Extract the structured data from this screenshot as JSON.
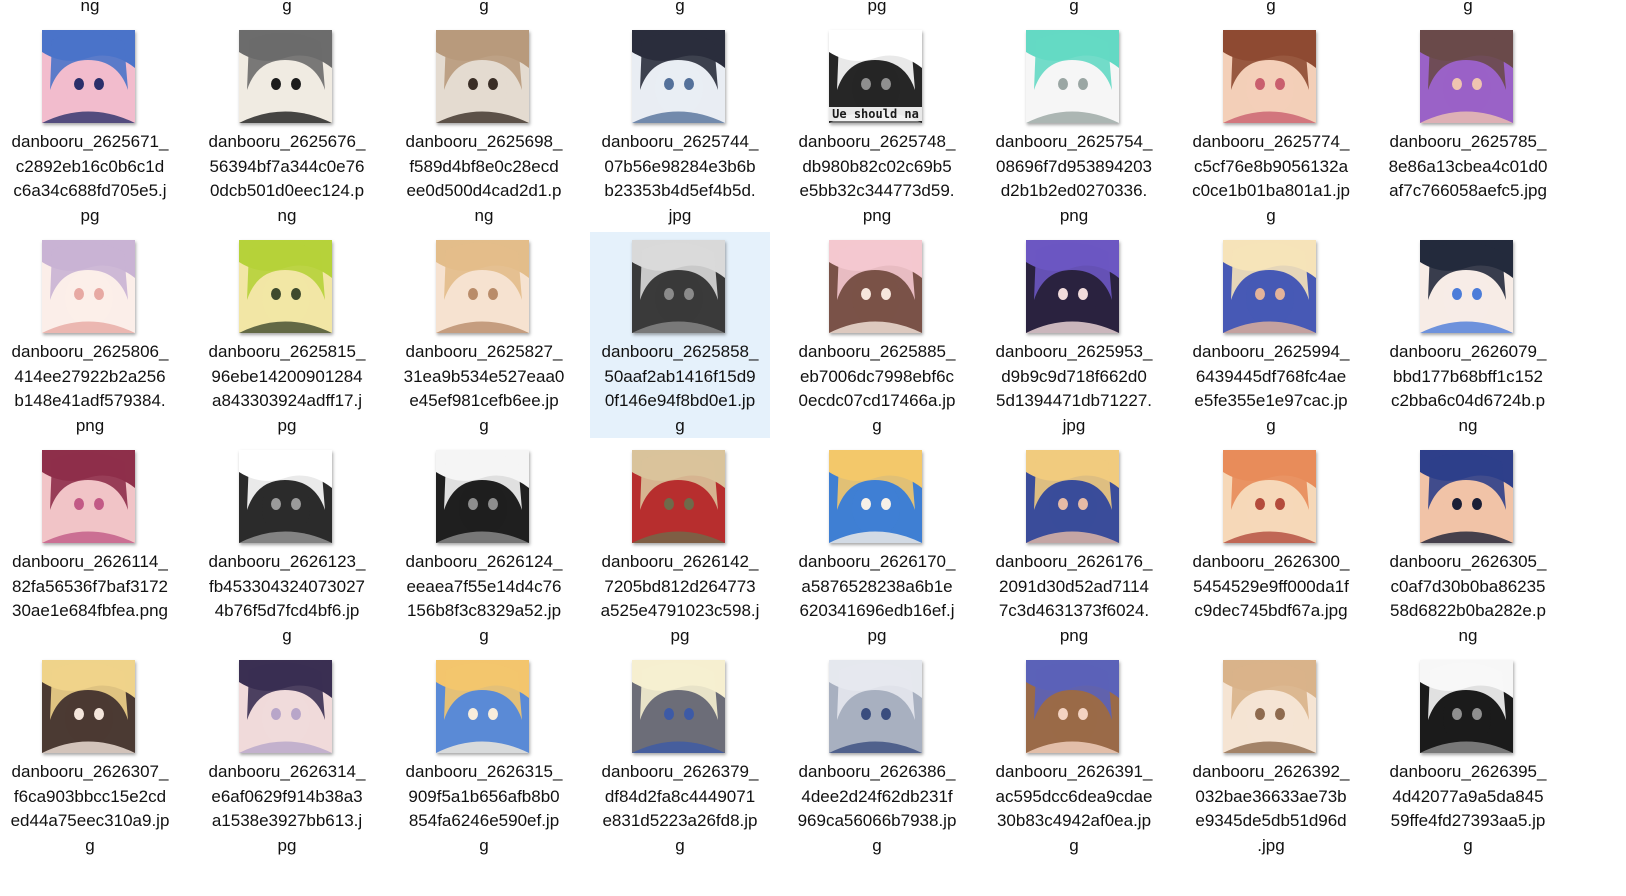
{
  "top_row_tails": [
    "ng",
    "g",
    "g",
    "g",
    "pg",
    "g",
    "g",
    "g"
  ],
  "files": [
    {
      "name_lines": [
        "danbooru_2625671_",
        "c2892eb16c0b6c1d",
        "c6a34c688fd705e5.j",
        "pg"
      ],
      "colors": [
        "#4a73c9",
        "#f2bccd",
        "#2b2f6a"
      ],
      "thumb_caption": ""
    },
    {
      "name_lines": [
        "danbooru_2625676_",
        "56394bf7a344c0e76",
        "0dcb501d0eec124.p",
        "ng"
      ],
      "colors": [
        "#6c6c6c",
        "#f0ebe2",
        "#1c1c1c"
      ],
      "thumb_caption": ""
    },
    {
      "name_lines": [
        "danbooru_2625698_",
        "f589d4bf8e0c28ecd",
        "ee0d500d4cad2d1.p",
        "ng"
      ],
      "colors": [
        "#b89a7c",
        "#e4dbd0",
        "#3a2e26"
      ],
      "thumb_caption": ""
    },
    {
      "name_lines": [
        "danbooru_2625744_",
        "07b56e98284e3b6b",
        "b23353b4d5ef4b5d.",
        "jpg"
      ],
      "colors": [
        "#2a2d3c",
        "#e9edf3",
        "#54719a"
      ],
      "thumb_caption": ""
    },
    {
      "name_lines": [
        "danbooru_2625748_",
        "db980b82c02c69b5",
        "e5bb32c344773d59.",
        "png"
      ],
      "colors": [
        "#ffffff",
        "#262626",
        "#8f8f8f"
      ],
      "thumb_caption": "Ue should na"
    },
    {
      "name_lines": [
        "danbooru_2625754_",
        "08696f7d953894203",
        "d2b1b2ed0270336.",
        "png"
      ],
      "colors": [
        "#64d9c4",
        "#f6f6f6",
        "#9aa6a3"
      ],
      "thumb_caption": ""
    },
    {
      "name_lines": [
        "danbooru_2625774_",
        "c5cf76e8b9056132a",
        "c0ce1b01ba801a1.jp",
        "g"
      ],
      "colors": [
        "#8e4a32",
        "#f3cfb8",
        "#c95f6e"
      ],
      "thumb_caption": ""
    },
    {
      "name_lines": [
        "danbooru_2625785_",
        "8e86a13cbea4c01d0",
        "af7c766058aefc5.jpg"
      ],
      "colors": [
        "#6a4a4a",
        "#9a62c7",
        "#efc4b0"
      ],
      "thumb_caption": ""
    },
    {
      "name_lines": [
        "danbooru_2625806_",
        "414ee27922b2a256",
        "b148e41adf579384.",
        "png"
      ],
      "colors": [
        "#c9b3d4",
        "#fbeee9",
        "#e7a9a3"
      ],
      "thumb_caption": ""
    },
    {
      "name_lines": [
        "danbooru_2625815_",
        "96ebe14200901284",
        "a843303924adff17.j",
        "pg"
      ],
      "colors": [
        "#b6d23a",
        "#f2e6a5",
        "#3f4a2d"
      ],
      "thumb_caption": ""
    },
    {
      "name_lines": [
        "danbooru_2625827_",
        "31ea9b534e527eaa0",
        "e45ef981cefb6ee.jp",
        "g"
      ],
      "colors": [
        "#e3bd8a",
        "#f6e2d0",
        "#b98c6a"
      ],
      "thumb_caption": ""
    },
    {
      "name_lines": [
        "danbooru_2625858_",
        "50aaf2ab1416f15d9",
        "0f146e94f8bd0e1.jp",
        "g"
      ],
      "colors": [
        "#d9d9d9",
        "#3a3a3a",
        "#8a8a8a"
      ],
      "thumb_caption": "",
      "selected": true
    },
    {
      "name_lines": [
        "danbooru_2625885_",
        "eb7006dc7998ebf6c",
        "0ecdc07cd17466a.jp",
        "g"
      ],
      "colors": [
        "#f4c8cf",
        "#7a5248",
        "#f6e7dd"
      ],
      "thumb_caption": ""
    },
    {
      "name_lines": [
        "danbooru_2625953_",
        "d9b9c9d718f662d0",
        "5d1394471db71227.",
        "jpg"
      ],
      "colors": [
        "#6c57c2",
        "#2a223f",
        "#f2dcdc"
      ],
      "thumb_caption": ""
    },
    {
      "name_lines": [
        "danbooru_2625994_",
        "6439445df768fc4ae",
        "e5fe355e1e97cac.jp",
        "g"
      ],
      "colors": [
        "#f6e3b9",
        "#4759b5",
        "#e3b39a"
      ],
      "thumb_caption": ""
    },
    {
      "name_lines": [
        "danbooru_2626079_",
        "bbd177b68bff1c152",
        "c2bba6c04d6724b.p",
        "ng"
      ],
      "colors": [
        "#232a3c",
        "#f7ece6",
        "#4b7cd9"
      ],
      "thumb_caption": ""
    },
    {
      "name_lines": [
        "danbooru_2626114_",
        "82fa56536f7baf3172",
        "30ae1e684fbfea.png"
      ],
      "colors": [
        "#8e2f4a",
        "#f1c4c7",
        "#c25a86"
      ],
      "thumb_caption": ""
    },
    {
      "name_lines": [
        "danbooru_2626123_",
        "fb453304324073027",
        "4b76f5d7fcd4bf6.jp",
        "g"
      ],
      "colors": [
        "#ffffff",
        "#2b2b2b",
        "#9a9a9a"
      ],
      "thumb_caption": ""
    },
    {
      "name_lines": [
        "danbooru_2626124_",
        "eeaea7f55e14d4c76",
        "156b8f3c8329a52.jp",
        "g"
      ],
      "colors": [
        "#f5f5f5",
        "#1f1f1f",
        "#8d8d8d"
      ],
      "thumb_caption": ""
    },
    {
      "name_lines": [
        "danbooru_2626142_",
        "7205bd812d264773",
        "a525e4791023c598.j",
        "pg"
      ],
      "colors": [
        "#d9c39b",
        "#b72e2e",
        "#6f6a4a"
      ],
      "thumb_caption": ""
    },
    {
      "name_lines": [
        "danbooru_2626170_",
        "a5876528238a6b1e",
        "620341696edb16ef.j",
        "pg"
      ],
      "colors": [
        "#f3c86a",
        "#3f7fd3",
        "#f7f1e8"
      ],
      "thumb_caption": ""
    },
    {
      "name_lines": [
        "danbooru_2626176_",
        "2091d30d52ad7114",
        "7c3d4631373f6024.",
        "png"
      ],
      "colors": [
        "#f1cb7e",
        "#3a4c9a",
        "#e7bba6"
      ],
      "thumb_caption": ""
    },
    {
      "name_lines": [
        "danbooru_2626300_",
        "5454529e9ff000da1f",
        "c9dec745bdf67a.jpg"
      ],
      "colors": [
        "#e88c5a",
        "#f6d8b8",
        "#b34b3c"
      ],
      "thumb_caption": ""
    },
    {
      "name_lines": [
        "danbooru_2626305_",
        "c0af7d30b0ba86235",
        "58d6822b0ba282e.p",
        "ng"
      ],
      "colors": [
        "#2e3f8a",
        "#f1c3a7",
        "#1b1f36"
      ],
      "thumb_caption": ""
    },
    {
      "name_lines": [
        "danbooru_2626307_",
        "f6ca903bbcc15e2cd",
        "ed44a75eec310a9.jp",
        "g"
      ],
      "colors": [
        "#efd38a",
        "#4b3a33",
        "#f4e6dc"
      ],
      "thumb_caption": ""
    },
    {
      "name_lines": [
        "danbooru_2626314_",
        "e6af0629f914b38a3",
        "a1538e3927bb613.j",
        "pg"
      ],
      "colors": [
        "#3a2f52",
        "#f0dada",
        "#b8a6c9"
      ],
      "thumb_caption": ""
    },
    {
      "name_lines": [
        "danbooru_2626315_",
        "909f5a1b656afb8b0",
        "854fa6246e590ef.jp",
        "g"
      ],
      "colors": [
        "#f3c56d",
        "#5a8ad6",
        "#f8eddc"
      ],
      "thumb_caption": ""
    },
    {
      "name_lines": [
        "danbooru_2626379_",
        "df84d2fa8c4449071",
        "e831d5223a26fd8.jp",
        "g"
      ],
      "colors": [
        "#f6efd0",
        "#6c6d78",
        "#3d5aa6"
      ],
      "thumb_caption": ""
    },
    {
      "name_lines": [
        "danbooru_2626386_",
        "4dee2d24f62db231f",
        "969ca56066b7938.jp",
        "g"
      ],
      "colors": [
        "#e5e8ee",
        "#a8b0c0",
        "#3a4d7e"
      ],
      "thumb_caption": ""
    },
    {
      "name_lines": [
        "danbooru_2626391_",
        "ac595dcc6dea9cdae",
        "30b83c4942af0ea.jp",
        "g"
      ],
      "colors": [
        "#5b62b8",
        "#9a6a48",
        "#f4d3c2"
      ],
      "thumb_caption": ""
    },
    {
      "name_lines": [
        "danbooru_2626392_",
        "032bae36633ae73b",
        "e9345de5db51d96d",
        ".jpg"
      ],
      "colors": [
        "#d9b38a",
        "#f5e4d3",
        "#8e6a4e"
      ],
      "thumb_caption": ""
    },
    {
      "name_lines": [
        "danbooru_2626395_",
        "4d42077a9a5da845",
        "59ffe4fd27393aa5.jp",
        "g"
      ],
      "colors": [
        "#f7f7f7",
        "#1b1b1b",
        "#909090"
      ],
      "thumb_caption": ""
    }
  ]
}
